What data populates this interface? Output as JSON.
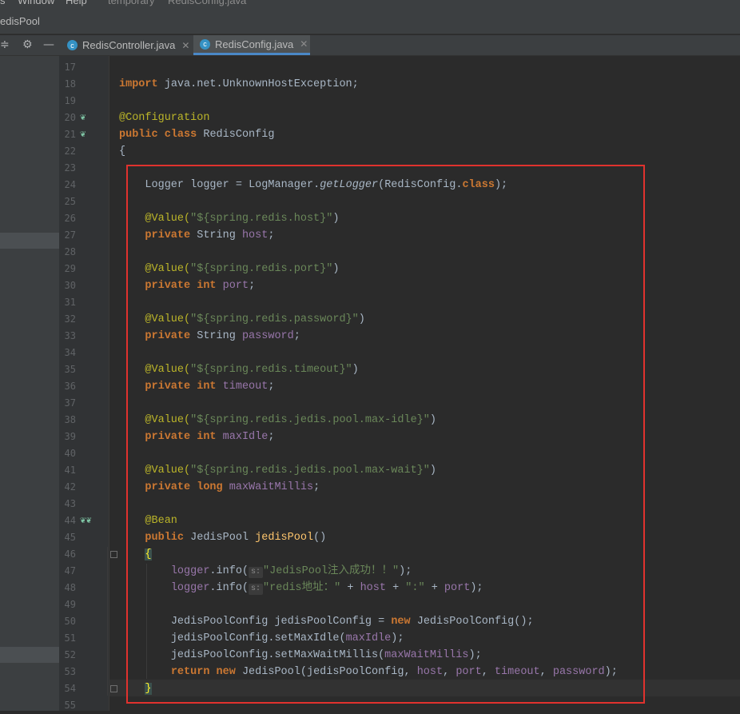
{
  "menu": {
    "items": [
      "s",
      "Window",
      "Help",
      "temporary",
      "RedisConfig.java"
    ]
  },
  "project": {
    "name": "edisPool"
  },
  "tabs": [
    {
      "label": "RedisController.java",
      "active": false
    },
    {
      "label": "RedisConfig.java",
      "active": true
    }
  ],
  "colors": {
    "highlight_border": "#e0322e",
    "accent": "#4a88c7"
  },
  "gutter": {
    "line_numbers": [
      "17",
      "18",
      "19",
      "20",
      "21",
      "22",
      "23",
      "24",
      "25",
      "26",
      "27",
      "28",
      "29",
      "30",
      "31",
      "32",
      "33",
      "34",
      "35",
      "36",
      "37",
      "38",
      "39",
      "40",
      "41",
      "42",
      "43",
      "44",
      "45",
      "46",
      "47",
      "48",
      "49",
      "50",
      "51",
      "52",
      "53",
      "54",
      "55"
    ]
  },
  "code": {
    "l18_import": "import",
    "l18_pkg": "java.net.UnknownHostException;",
    "l20_ann": "@Configuration",
    "l21_public": "public",
    "l21_class": "class",
    "l21_name": "RedisConfig",
    "l22": "{",
    "l24_type": "Logger",
    "l24_var": "logger",
    "l24_eq": "=",
    "l24_cls": "LogManager.",
    "l24_m": "getLogger",
    "l24_arg": "(RedisConfig.",
    "l24_kw": "class",
    "l24_end": ");",
    "l26_ann": "@Value(",
    "l26_str": "\"${spring.redis.host}\"",
    "l26_end": ")",
    "l27_mod": "private",
    "l27_type": "String",
    "l27_f": "host",
    "l29_ann": "@Value(",
    "l29_str": "\"${spring.redis.port}\"",
    "l29_end": ")",
    "l30_mod": "private",
    "l30_type": "int",
    "l30_f": "port",
    "l32_ann": "@Value(",
    "l32_str": "\"${spring.redis.password}\"",
    "l32_end": ")",
    "l33_mod": "private",
    "l33_type": "String",
    "l33_f": "password",
    "l35_ann": "@Value(",
    "l35_str": "\"${spring.redis.timeout}\"",
    "l35_end": ")",
    "l36_mod": "private",
    "l36_type": "int",
    "l36_f": "timeout",
    "l38_ann": "@Value(",
    "l38_str": "\"${spring.redis.jedis.pool.max-idle}\"",
    "l38_end": ")",
    "l39_mod": "private",
    "l39_type": "int",
    "l39_f": "maxIdle",
    "l41_ann": "@Value(",
    "l41_str": "\"${spring.redis.jedis.pool.max-wait}\"",
    "l41_end": ")",
    "l42_mod": "private",
    "l42_type": "long",
    "l42_f": "maxWaitMillis",
    "l44_ann": "@Bean",
    "l45_public": "public",
    "l45_type": "JedisPool",
    "l45_m": "jedisPool",
    "l45_end": "()",
    "l46": "{",
    "l47_obj": "logger",
    "l47_m": ".info(",
    "l47_hint": "s:",
    "l47_str": "\"JedisPool注入成功！！\"",
    "l47_end": ");",
    "l48_obj": "logger",
    "l48_m": ".info(",
    "l48_hint": "s:",
    "l48_str": "\"redis地址：\"",
    "l48_plus1": " + ",
    "l48_host": "host",
    "l48_plus2": " + ",
    "l48_colon": "\":\"",
    "l48_plus3": " + ",
    "l48_port": "port",
    "l48_end": ");",
    "l50_type": "JedisPoolConfig",
    "l50_var": "jedisPoolConfig",
    "l50_eq": "=",
    "l50_new": "new",
    "l50_cls": "JedisPoolConfig",
    "l50_end": "();",
    "l51_obj": "jedisPoolConfig.",
    "l51_m": "setMaxIdle",
    "l51_p": "(",
    "l51_f": "maxIdle",
    "l51_end": ");",
    "l52_obj": "jedisPoolConfig.",
    "l52_m": "setMaxWaitMillis",
    "l52_p": "(",
    "l52_f": "maxWaitMillis",
    "l52_end": ");",
    "l53_return": "return",
    "l53_new": "new",
    "l53_cls": "JedisPool",
    "l53_args1": "(jedisPoolConfig, ",
    "l53_host": "host",
    "l53_c1": ", ",
    "l53_port": "port",
    "l53_c2": ", ",
    "l53_timeout": "timeout",
    "l53_c3": ", ",
    "l53_password": "password",
    "l53_end": ");",
    "l54": "}"
  }
}
